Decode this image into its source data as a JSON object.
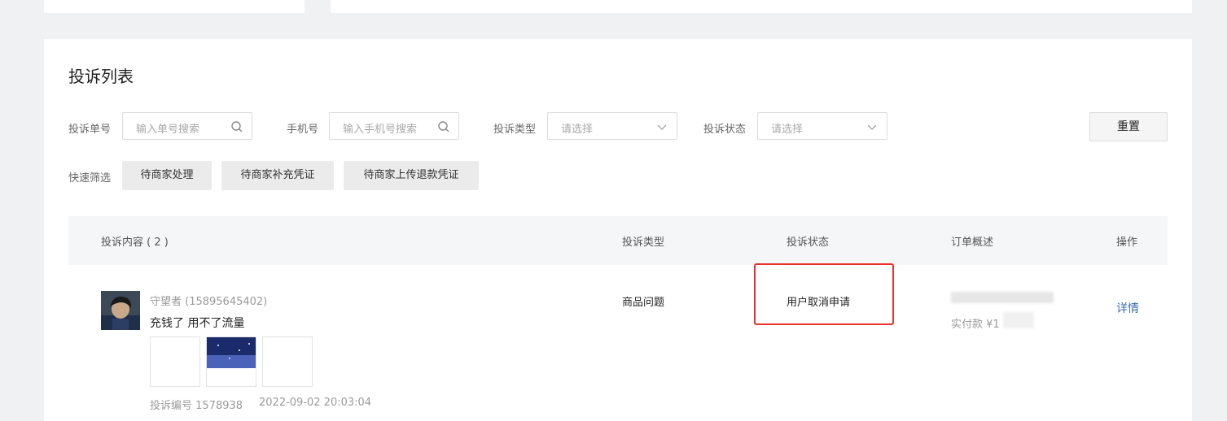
{
  "page": {
    "title": "投诉列表"
  },
  "filters": {
    "complaint_no": {
      "label": "投诉单号",
      "placeholder": "输入单号搜索"
    },
    "phone": {
      "label": "手机号",
      "placeholder": "输入手机号搜索"
    },
    "type": {
      "label": "投诉类型",
      "placeholder": "请选择"
    },
    "status": {
      "label": "投诉状态",
      "placeholder": "请选择"
    },
    "reset_label": "重置",
    "quick_label": "快速筛选",
    "quick": [
      "待商家处理",
      "待商家补充凭证",
      "待商家上传退款凭证"
    ]
  },
  "table": {
    "headers": {
      "content": "投诉内容 ( 2 )",
      "type": "投诉类型",
      "status": "投诉状态",
      "order": "订单概述",
      "action": "操作"
    },
    "rows": [
      {
        "user": "守望者 (15895645402)",
        "content": "充钱了 用不了流量",
        "complaint_no": "投诉编号 1578938",
        "time": "2022-09-02 20:03:04",
        "type": "商品问题",
        "status": "用户取消申请",
        "paid_prefix": "实付款 ¥1",
        "action": "详情"
      }
    ]
  },
  "colors": {
    "highlight": "#e8322b",
    "link": "#3c6db5",
    "background": "#f0f1f3"
  }
}
